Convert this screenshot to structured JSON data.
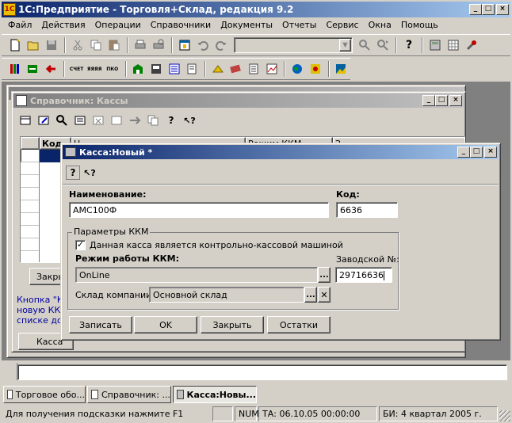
{
  "app": {
    "title": "1С:Предприятие - Торговля+Склад, редакция 9.2"
  },
  "menu": {
    "items": [
      "Файл",
      "Действия",
      "Операции",
      "Справочники",
      "Документы",
      "Отчеты",
      "Сервис",
      "Окна",
      "Помощь"
    ]
  },
  "icons": {
    "toolbar1": [
      "new-document-icon",
      "open-folder-icon",
      "save-icon",
      "cut-icon",
      "copy-icon",
      "paste-icon",
      "print-icon",
      "print-preview-icon",
      "calendar-icon",
      "undo-icon",
      "redo-icon",
      "search-combo-icon",
      "find-icon",
      "find-next-icon",
      "help-icon",
      "calculator-icon",
      "calendar-grid-icon",
      "tools-icon"
    ],
    "toolbar2": [
      "books-icon",
      "exchange-icon",
      "arrow-back-icon",
      "account-icon",
      "account2-icon",
      "pkko-icon",
      "warehouse-icon",
      "register-icon",
      "journal-icon",
      "document-icon",
      "calc-icon",
      "tickets-icon",
      "pencil-icon",
      "report-icon",
      "chart-icon",
      "globe-icon",
      "star-icon",
      "image-icon"
    ]
  },
  "catalog_window": {
    "title": "Справочник: Кассы",
    "grid_headers": [
      "Код",
      "Н",
      "Режим ККМ",
      "З"
    ],
    "close_label": "Закрыть",
    "hint_lines": [
      "Кнопка \"К",
      "новую ККМ",
      "списке до"
    ],
    "kassa_button": "Касса"
  },
  "dialog": {
    "title": "Касса:Новый *",
    "name_label": "Наименование:",
    "name_value": "АМС100Ф",
    "code_label": "Код:",
    "code_value": "6636",
    "group_label": "Параметры ККМ",
    "checkbox_label": "Данная касса является контрольно-кассовой машиной",
    "checkbox_checked": true,
    "mode_label": "Режим работы ККМ:",
    "mode_value": "OnLine",
    "serial_label": "Заводской №:",
    "serial_value": "29716636",
    "warehouse_label": "Склад компании:",
    "warehouse_value": "Основной склад",
    "buttons": {
      "write": "Записать",
      "ok": "OK",
      "close": "Закрыть",
      "balances": "Остатки"
    }
  },
  "taskbar": {
    "items": [
      "Торговое обо...",
      "Справочник: ...",
      "Касса:Новы..."
    ]
  },
  "statusbar": {
    "hint": "Для получения подсказки нажмите F1",
    "num": "NUM",
    "ta": "ТА: 06.10.05  00:00:00",
    "bi": "БИ: 4 квартал 2005 г."
  },
  "colors": {
    "title_active": "#0a246a",
    "title_inactive": "#808080",
    "hint_text": "#0000a0",
    "selection": "#0a246a"
  }
}
